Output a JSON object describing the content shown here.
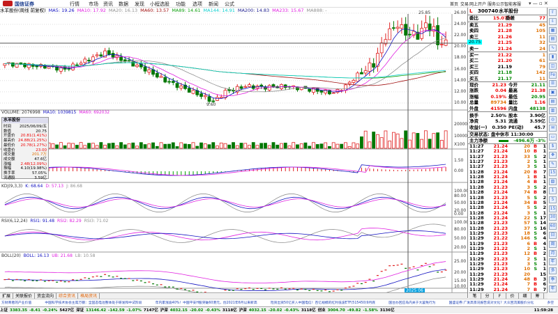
{
  "app": {
    "logo": "国信证券",
    "menus": [
      "行情",
      "市场",
      "资讯",
      "数据",
      "发现",
      "小程选股",
      "功能",
      "选项",
      "新闻",
      "公式"
    ],
    "right_menus": [
      "首页",
      "交易",
      "网上开户",
      "服务公示",
      "智能客服"
    ]
  },
  "chart_header": {
    "title": "水羊股份(周线 前复权)",
    "ma": [
      {
        "label": "MA5: 19.26",
        "color": "#1010c0"
      },
      {
        "label": "MA10: 17.92",
        "color": "#e020e0"
      },
      {
        "label": "MA20: 16.13",
        "color": "#909090"
      },
      {
        "label": "MA60: 13.57",
        "color": "#a01010"
      },
      {
        "label": "MA89: 14.61",
        "color": "#10a010"
      },
      {
        "label": "MA144: 14.91",
        "color": "#10d0d0"
      },
      {
        "label": "MA200: 14.83",
        "color": "#202090"
      },
      {
        "label": "MA233: 15.67",
        "color": "#e020e0"
      },
      {
        "label": "MA888: -",
        "color": "#909090"
      }
    ]
  },
  "chart_data": {
    "type": "candlestick",
    "period": "weekly",
    "close_keypoints": [
      [
        0,
        17
      ],
      [
        10,
        16.5
      ],
      [
        15,
        16
      ],
      [
        20,
        17.5
      ],
      [
        25,
        19
      ],
      [
        30,
        17.5
      ],
      [
        35,
        16
      ],
      [
        40,
        14
      ],
      [
        45,
        12.5
      ],
      [
        50,
        11
      ],
      [
        52,
        10.2
      ],
      [
        55,
        12
      ],
      [
        60,
        13
      ],
      [
        65,
        12.8
      ],
      [
        70,
        13
      ],
      [
        75,
        12.5
      ],
      [
        80,
        12
      ],
      [
        82,
        11.8
      ],
      [
        85,
        13
      ],
      [
        88,
        15
      ],
      [
        92,
        17
      ],
      [
        95,
        22
      ],
      [
        98,
        24
      ],
      [
        100,
        22.5
      ],
      [
        103,
        22
      ],
      [
        105,
        24
      ],
      [
        107,
        23
      ],
      [
        108,
        20.5
      ],
      [
        110,
        21.23
      ]
    ],
    "price_axis": [
      "26.00",
      "24.00",
      "22.00",
      "20.00",
      "18.00",
      "16.00",
      "14.00",
      "12.00",
      "10.00"
    ],
    "annotations": {
      "high": "25.85",
      "low": "9.60",
      "crosshair_price": "20.75",
      "crosshair_date": "2025 06"
    }
  },
  "volume": {
    "header": [
      "VOLUME: 2076998",
      "MA10: 1039815",
      "MA60: 692032"
    ],
    "axis": [
      "20000",
      "10000",
      "X100"
    ]
  },
  "macd": {
    "header": [
      "EA: 1.25",
      "MACD: 1.18"
    ],
    "axis": [
      "1.50",
      "0.00"
    ]
  },
  "kdj": {
    "header": [
      "KDJ(9,3,3)",
      "K: 68.64",
      "D: 57.13",
      "J: 86.68"
    ],
    "axis": [
      "100.00",
      "80.00",
      "50.00",
      "20.00",
      "0.00"
    ]
  },
  "rsi": {
    "header": [
      "RSI(6,12,24)",
      "RSI1: 91.48",
      "RSI2: 82.29",
      "RSI3: 71.02"
    ],
    "axis": [
      "100.00",
      "80.00",
      "50.00",
      "20.00"
    ]
  },
  "boll": {
    "header": [
      "BOLL(20)",
      "BOLL: 16.13",
      "UB: 21.68",
      "LB: 10.58"
    ],
    "axis": [
      "25.00",
      "20.00",
      "15.00",
      "10.00"
    ]
  },
  "info_window": {
    "title": "水羊股份",
    "rows": [
      [
        "时间",
        "2025/06/09/五"
      ],
      [
        "数值",
        "20.75"
      ],
      [
        "开盘价",
        "20.81(1.41%)"
      ],
      [
        "最高价",
        "24.88(21.25%)"
      ],
      [
        "最低价",
        "20.78(1.27%)"
      ],
      [
        "收盘价",
        "23.00"
      ],
      [
        "成交量",
        "201.7万"
      ],
      [
        "成交额",
        "47.6亿"
      ],
      [
        "涨幅",
        "2.48(12.09%)"
      ],
      [
        "振幅",
        "4.10(19.98%)"
      ],
      [
        "换手率",
        "57.05%"
      ],
      [
        "流通股",
        "3.59亿"
      ]
    ]
  },
  "quote": {
    "flag": "L",
    "code": "300740",
    "name": "水羊股份",
    "ratio": [
      "委比",
      "15.07%",
      "委差",
      "77"
    ],
    "asks": [
      [
        "卖五",
        "21.29",
        "45"
      ],
      [
        "卖四",
        "21.28",
        "105"
      ],
      [
        "卖三",
        "21.26",
        "11"
      ],
      [
        "卖二",
        "21.25",
        "32"
      ],
      [
        "卖一",
        "21.24",
        "24"
      ]
    ],
    "bids": [
      [
        "买一",
        "21.22",
        "1"
      ],
      [
        "买二",
        "21.20",
        "61"
      ],
      [
        "买三",
        "21.19",
        "79"
      ],
      [
        "买四",
        "21.18",
        "142"
      ],
      [
        "买五",
        "21.17",
        "11"
      ]
    ],
    "stats": [
      [
        "现价",
        "21.23",
        "今开",
        "21.11"
      ],
      [
        "涨跌",
        "0.04",
        "最高",
        "21.38"
      ],
      [
        "涨幅",
        "0.19%",
        "最低",
        "20.95"
      ],
      [
        "总量",
        "89734",
        "量比",
        "1.16"
      ],
      [
        "外盘",
        "41596",
        "内盘",
        "48138"
      ],
      [
        "换手",
        "2.50%",
        "股本",
        "3.90亿"
      ],
      [
        "净资",
        "5.31",
        "流通",
        "3.59亿"
      ],
      [
        "收益(一)",
        "0.350",
        "PE(动)",
        "45.7"
      ]
    ],
    "trade_state": "交易状态: 盘中休市 11:30:00",
    "main_flow": [
      "主力净额",
      "-496.6万",
      "-3%"
    ],
    "ticks": [
      [
        "11:27",
        "21.24",
        "20",
        "B",
        "1"
      ],
      [
        "11:27",
        "21.24",
        "10",
        "B",
        "1"
      ],
      [
        "11:27",
        "21.23",
        "33",
        "S",
        "2"
      ],
      [
        "11:27",
        "21.23",
        "2",
        "S",
        "1"
      ],
      [
        "11:27",
        "21.23",
        "3",
        "S",
        "1"
      ],
      [
        "11:28",
        "21.24",
        "20",
        "B",
        "7"
      ],
      [
        "11:28",
        "21.24",
        "1",
        "B",
        "1"
      ],
      [
        "11:28",
        "21.24",
        "4",
        "B",
        "1"
      ],
      [
        "11:28",
        "21.23",
        "3",
        "S",
        "2"
      ],
      [
        "11:28",
        "21.24",
        "74",
        "B",
        "8"
      ],
      [
        "11:28",
        "21.23",
        "5",
        "S",
        "2"
      ],
      [
        "11:28",
        "21.24",
        "34",
        "B",
        "5"
      ],
      [
        "11:28",
        "21.24",
        "5",
        "S",
        "2"
      ],
      [
        "11:28",
        "21.24",
        "3",
        "S",
        "1"
      ],
      [
        "11:28",
        "21.24",
        "22",
        "S",
        "17"
      ],
      [
        "11:28",
        "21.23",
        "57",
        "S",
        "14"
      ],
      [
        "11:28",
        "21.23",
        "37",
        "S",
        "16"
      ],
      [
        "11:29",
        "21.23",
        "18",
        "S",
        "6"
      ],
      [
        "11:29",
        "21.22",
        "146",
        "S",
        "4"
      ],
      [
        "11:29",
        "21.23",
        "6",
        "B",
        "4"
      ],
      [
        "11:29",
        "21.22",
        "2",
        "S",
        "1"
      ],
      [
        "11:29",
        "21.23",
        "12",
        "B",
        "2"
      ],
      [
        "11:29",
        "21.23",
        "2",
        "S",
        "1"
      ],
      [
        "11:29",
        "21.23",
        "3",
        "S",
        "1"
      ],
      [
        "11:29",
        "21.23",
        "10",
        "S",
        "1"
      ],
      [
        "11:29",
        "21.23",
        "20",
        "",
        "15"
      ],
      [
        "11:29",
        "21.24",
        "48",
        "B",
        "3"
      ],
      [
        "11:29",
        "21.24",
        "7",
        "B",
        "6"
      ],
      [
        "11:29",
        "21.24",
        "7",
        "B",
        "7"
      ],
      [
        "11:29",
        "21.23",
        "43",
        "S",
        "5"
      ]
    ]
  },
  "toolbar": [
    "⇧",
    "⇩",
    "▦",
    "▤",
    "∿",
    "▮",
    "◫",
    "Fe",
    "☰",
    "▣",
    "▤",
    "▥",
    "◎",
    "✉",
    "▭",
    "$",
    "✥",
    "✎",
    "15",
    "▧",
    "1",
    "5",
    "15",
    "30",
    "60",
    "日",
    "周",
    "月",
    "年",
    "多",
    "季",
    "年"
  ],
  "tabs": [
    "扩展",
    "关联报价",
    "资金流向",
    "综合资讯",
    "格局资讯"
  ],
  "bottom_buttons": [
    "笔",
    "分",
    "F",
    "价",
    "细",
    "筹"
  ],
  "news": [
    "方财商者的产业价值",
    "中国科学技术协会主席万钢：全固态电池整体处于研发和中试阶段",
    "年内累涨逾40%！中国平安H股突破60港元，创2021年6月以来新高",
    "险资出资50亿买入中国电信！百亿规模的红利低波ETF(515450)9月底",
    "国台办回应岛内关于大罢免行为",
    "国盛证券:广发高景况报告说对文化？大众回流美股价分化",
    "多空"
  ],
  "status": {
    "indices": [
      [
        "上证",
        "3383.35",
        "-8.41",
        "-0.24%",
        "5427亿"
      ],
      [
        "深证",
        "13146.42",
        "-142.59",
        "-1.07%",
        "7147亿"
      ],
      [
        "沪深",
        "4032.15",
        "-20.02",
        "-0.43%",
        "3118亿"
      ],
      [
        "沪深",
        "4032.15",
        "-20.02",
        "-0.43%",
        "3118亿"
      ],
      [
        "创业",
        "3004.70",
        "-49.82",
        "-1.58%",
        "3136亿"
      ]
    ],
    "time": "11:59:28"
  }
}
